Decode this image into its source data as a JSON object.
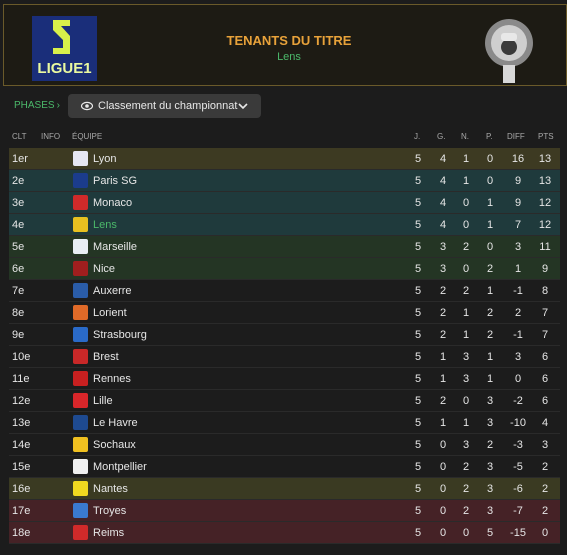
{
  "header": {
    "logo_text": "LIGUE1",
    "title": "TENANTS DU TITRE",
    "holder": "Lens"
  },
  "phases": {
    "label": "PHASES",
    "arrow": "›"
  },
  "dropdown": {
    "label": "Classement du championnat"
  },
  "columns": {
    "pos": "CLT",
    "info": "INFO",
    "team": "ÉQUIPE",
    "played": "J.",
    "won": "G.",
    "drawn": "N.",
    "lost": "P.",
    "diff": "DIFF",
    "pts": "PTS"
  },
  "rows": [
    {
      "pos": "1er",
      "team": "Lyon",
      "j": "5",
      "g": "4",
      "n": "1",
      "p": "0",
      "diff": "16",
      "pts": "13",
      "bg": "#3d3a22",
      "badge": "#e6e6f2"
    },
    {
      "pos": "2e",
      "team": "Paris SG",
      "j": "5",
      "g": "4",
      "n": "1",
      "p": "0",
      "diff": "9",
      "pts": "13",
      "bg": "#1f3a3c",
      "badge": "#1b3c8c"
    },
    {
      "pos": "3e",
      "team": "Monaco",
      "j": "5",
      "g": "4",
      "n": "0",
      "p": "1",
      "diff": "9",
      "pts": "12",
      "bg": "#1f3a3c",
      "badge": "#d02a2a"
    },
    {
      "pos": "4e",
      "team": "Lens",
      "j": "5",
      "g": "4",
      "n": "0",
      "p": "1",
      "diff": "7",
      "pts": "12",
      "bg": "#1f3a3c",
      "badge": "#e8c020"
    },
    {
      "pos": "5e",
      "team": "Marseille",
      "j": "5",
      "g": "3",
      "n": "2",
      "p": "0",
      "diff": "3",
      "pts": "11",
      "bg": "#243524",
      "badge": "#e8eef4"
    },
    {
      "pos": "6e",
      "team": "Nice",
      "j": "5",
      "g": "3",
      "n": "0",
      "p": "2",
      "diff": "1",
      "pts": "9",
      "bg": "#243524",
      "badge": "#a01e1e"
    },
    {
      "pos": "7e",
      "team": "Auxerre",
      "j": "5",
      "g": "2",
      "n": "2",
      "p": "1",
      "diff": "-1",
      "pts": "8",
      "bg": "#1c1c1c",
      "badge": "#2a5ca8"
    },
    {
      "pos": "8e",
      "team": "Lorient",
      "j": "5",
      "g": "2",
      "n": "1",
      "p": "2",
      "diff": "2",
      "pts": "7",
      "bg": "#1c1c1c",
      "badge": "#e06a28"
    },
    {
      "pos": "9e",
      "team": "Strasbourg",
      "j": "5",
      "g": "2",
      "n": "1",
      "p": "2",
      "diff": "-1",
      "pts": "7",
      "bg": "#1c1c1c",
      "badge": "#2a6ac8"
    },
    {
      "pos": "10e",
      "team": "Brest",
      "j": "5",
      "g": "1",
      "n": "3",
      "p": "1",
      "diff": "3",
      "pts": "6",
      "bg": "#1c1c1c",
      "badge": "#c82828"
    },
    {
      "pos": "11e",
      "team": "Rennes",
      "j": "5",
      "g": "1",
      "n": "3",
      "p": "1",
      "diff": "0",
      "pts": "6",
      "bg": "#1c1c1c",
      "badge": "#c82020"
    },
    {
      "pos": "12e",
      "team": "Lille",
      "j": "5",
      "g": "2",
      "n": "0",
      "p": "3",
      "diff": "-2",
      "pts": "6",
      "bg": "#1c1c1c",
      "badge": "#d8262a"
    },
    {
      "pos": "13e",
      "team": "Le Havre",
      "j": "5",
      "g": "1",
      "n": "1",
      "p": "3",
      "diff": "-10",
      "pts": "4",
      "bg": "#1c1c1c",
      "badge": "#1e4a90"
    },
    {
      "pos": "14e",
      "team": "Sochaux",
      "j": "5",
      "g": "0",
      "n": "3",
      "p": "2",
      "diff": "-3",
      "pts": "3",
      "bg": "#1c1c1c",
      "badge": "#f0c020"
    },
    {
      "pos": "15e",
      "team": "Montpellier",
      "j": "5",
      "g": "0",
      "n": "2",
      "p": "3",
      "diff": "-5",
      "pts": "2",
      "bg": "#1c1c1c",
      "badge": "#f0f0f0"
    },
    {
      "pos": "16e",
      "team": "Nantes",
      "j": "5",
      "g": "0",
      "n": "2",
      "p": "3",
      "diff": "-6",
      "pts": "2",
      "bg": "#3a3a22",
      "badge": "#f0d820"
    },
    {
      "pos": "17e",
      "team": "Troyes",
      "j": "5",
      "g": "0",
      "n": "2",
      "p": "3",
      "diff": "-7",
      "pts": "2",
      "bg": "#452226",
      "badge": "#3a7ad0"
    },
    {
      "pos": "18e",
      "team": "Reims",
      "j": "5",
      "g": "0",
      "n": "0",
      "p": "5",
      "diff": "-15",
      "pts": "0",
      "bg": "#452226",
      "badge": "#d02a2a"
    }
  ],
  "highlight_team": "Lens"
}
